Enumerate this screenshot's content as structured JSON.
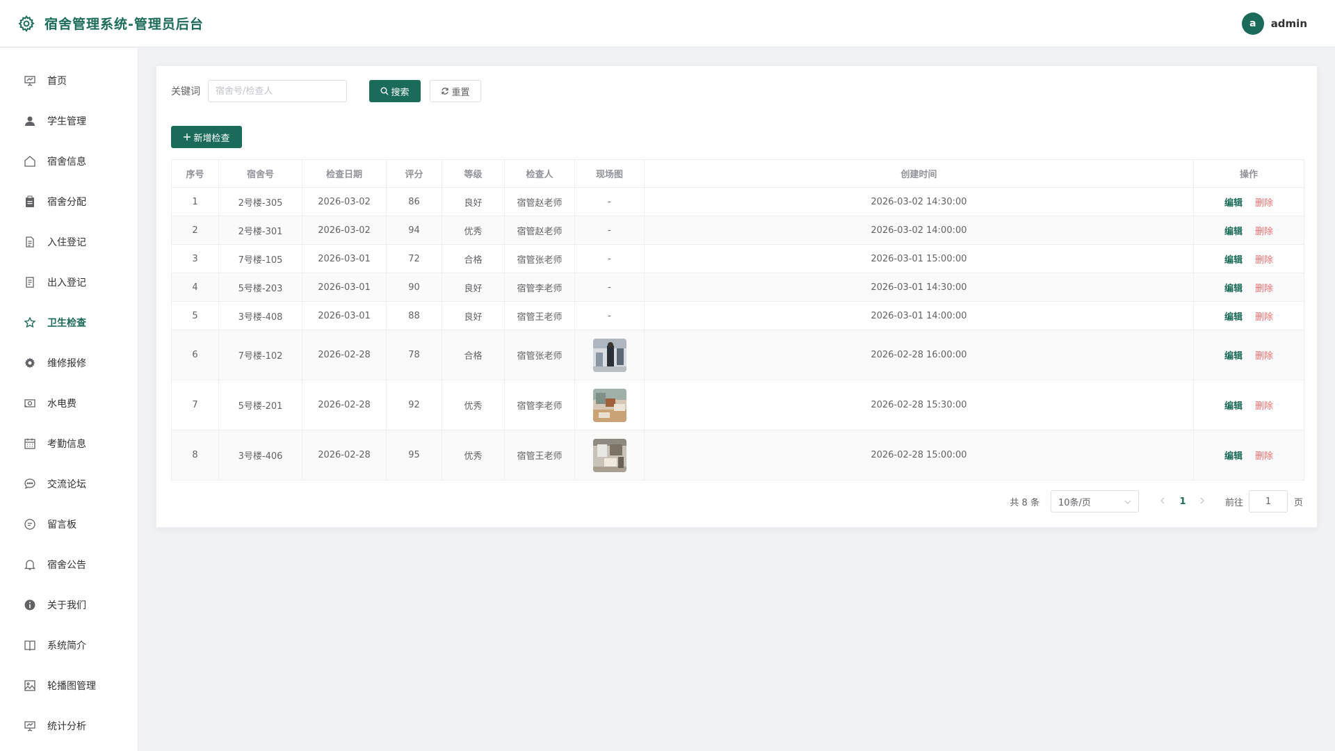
{
  "header": {
    "title": "宿舍管理系统-管理员后台",
    "avatar_letter": "a",
    "username": "admin",
    "brand_color": "#1b6b5a"
  },
  "sidebar": {
    "items": [
      {
        "label": "首页",
        "icon": "presentation-icon"
      },
      {
        "label": "学生管理",
        "icon": "user-icon"
      },
      {
        "label": "宿舍信息",
        "icon": "house-icon"
      },
      {
        "label": "宿舍分配",
        "icon": "clipboard-icon"
      },
      {
        "label": "入住登记",
        "icon": "document-icon"
      },
      {
        "label": "出入登记",
        "icon": "list-document-icon"
      },
      {
        "label": "卫生检查",
        "icon": "star-icon",
        "active": true
      },
      {
        "label": "维修报修",
        "icon": "gear-icon"
      },
      {
        "label": "水电费",
        "icon": "money-icon"
      },
      {
        "label": "考勤信息",
        "icon": "calendar-icon"
      },
      {
        "label": "交流论坛",
        "icon": "chat-dots-icon"
      },
      {
        "label": "留言板",
        "icon": "chat-lines-icon"
      },
      {
        "label": "宿舍公告",
        "icon": "bell-icon"
      },
      {
        "label": "关于我们",
        "icon": "info-icon"
      },
      {
        "label": "系统简介",
        "icon": "book-icon"
      },
      {
        "label": "轮播图管理",
        "icon": "picture-icon"
      },
      {
        "label": "统计分析",
        "icon": "chart-board-icon"
      }
    ]
  },
  "search": {
    "label": "关键词",
    "placeholder": "宿舍号/检查人",
    "value": "",
    "search_button": "搜索",
    "reset_button": "重置"
  },
  "add_button": "新增检查",
  "table": {
    "columns": [
      "序号",
      "宿舍号",
      "检查日期",
      "评分",
      "等级",
      "检查人",
      "现场图",
      "创建时间",
      "操作"
    ],
    "rows": [
      {
        "no": "1",
        "room": "2号楼-305",
        "date": "2026-03-02",
        "score": "86",
        "grade": "良好",
        "inspector": "宿管赵老师",
        "photo": "-",
        "created": "2026-03-02 14:30:00"
      },
      {
        "no": "2",
        "room": "2号楼-301",
        "date": "2026-03-02",
        "score": "94",
        "grade": "优秀",
        "inspector": "宿管赵老师",
        "photo": "-",
        "created": "2026-03-02 14:00:00"
      },
      {
        "no": "3",
        "room": "7号楼-105",
        "date": "2026-03-01",
        "score": "72",
        "grade": "合格",
        "inspector": "宿管张老师",
        "photo": "-",
        "created": "2026-03-01 15:00:00"
      },
      {
        "no": "4",
        "room": "5号楼-203",
        "date": "2026-03-01",
        "score": "90",
        "grade": "良好",
        "inspector": "宿管李老师",
        "photo": "-",
        "created": "2026-03-01 14:30:00"
      },
      {
        "no": "5",
        "room": "3号楼-408",
        "date": "2026-03-01",
        "score": "88",
        "grade": "良好",
        "inspector": "宿管王老师",
        "photo": "-",
        "created": "2026-03-01 14:00:00"
      },
      {
        "no": "6",
        "room": "7号楼-102",
        "date": "2026-02-28",
        "score": "78",
        "grade": "合格",
        "inspector": "宿管张老师",
        "photo": "image",
        "created": "2026-02-28 16:00:00"
      },
      {
        "no": "7",
        "room": "5号楼-201",
        "date": "2026-02-28",
        "score": "92",
        "grade": "优秀",
        "inspector": "宿管李老师",
        "photo": "image",
        "created": "2026-02-28 15:30:00"
      },
      {
        "no": "8",
        "room": "3号楼-406",
        "date": "2026-02-28",
        "score": "95",
        "grade": "优秀",
        "inspector": "宿管王老师",
        "photo": "image",
        "created": "2026-02-28 15:00:00"
      }
    ],
    "edit_label": "编辑",
    "delete_label": "删除"
  },
  "pagination": {
    "total": "共 8 条",
    "page_size": "10条/页",
    "current_page": "1",
    "goto_label": "前往",
    "goto_value": "1",
    "page_unit": "页"
  }
}
